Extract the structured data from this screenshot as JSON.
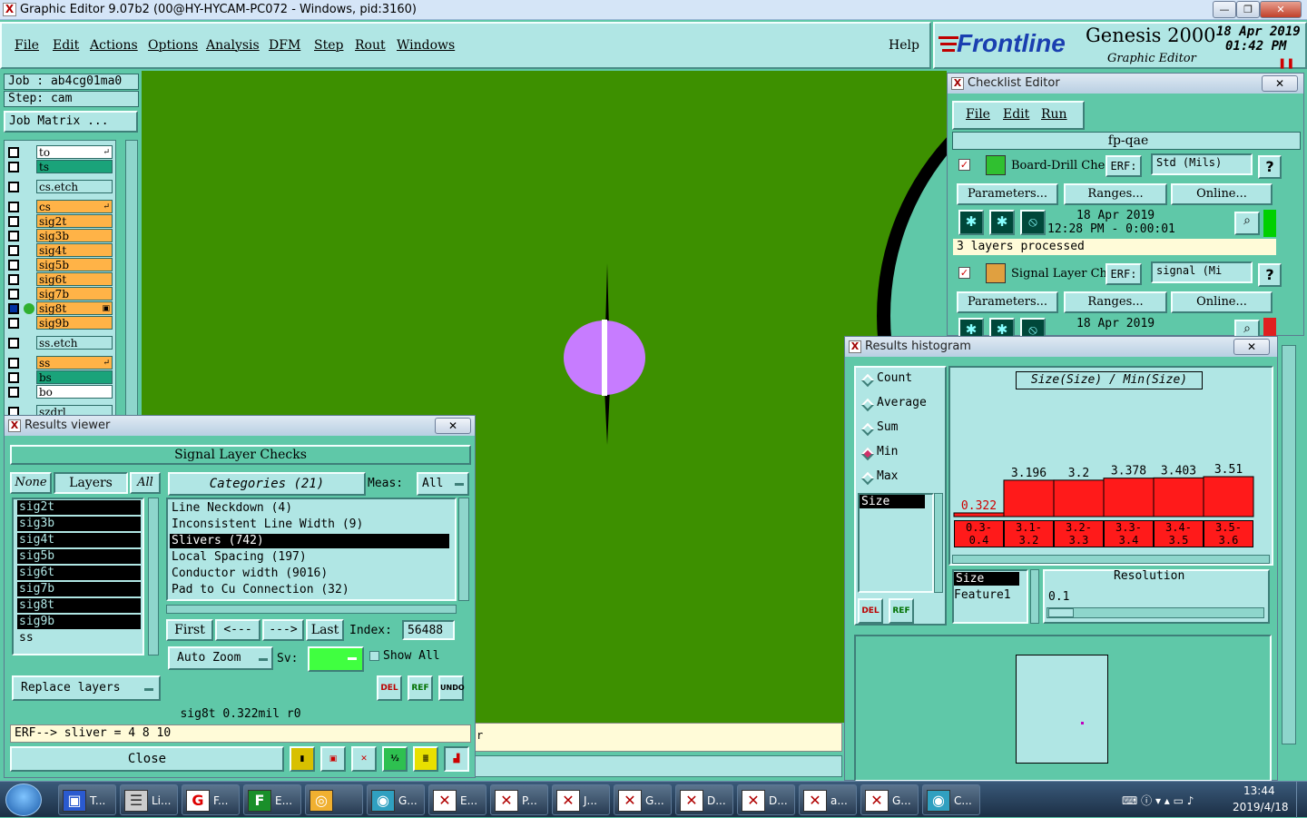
{
  "window": {
    "title": "Graphic Editor 9.07b2 (00@HY-HYCAM-PC072 - Windows, pid:3160)",
    "min": "—",
    "max": "❐",
    "close": "✕"
  },
  "menu": [
    "File",
    "Edit",
    "Actions",
    "Options",
    "Analysis",
    "DFM",
    "Step",
    "Rout",
    "Windows"
  ],
  "help": "Help",
  "brand": {
    "logo": "Frontline",
    "product": "Genesis 2000",
    "subtitle": "Graphic Editor",
    "date": "18 Apr 2019",
    "time": "01:42 PM",
    "accent": "#c00000"
  },
  "job": {
    "job_text": "Job : ab4cg01ma0",
    "step_text": "Step: cam",
    "matrix_button": "Job Matrix ..."
  },
  "layers": [
    {
      "name": "to",
      "color": "#ffffff",
      "mark": "↵"
    },
    {
      "name": "ts",
      "color": "#1aa37a",
      "mark": ""
    },
    {
      "name": "cs.etch",
      "color": "#b0e6e4",
      "mark": ""
    },
    {
      "name": "cs",
      "color": "#ffb347",
      "mark": "↵"
    },
    {
      "name": "sig2t",
      "color": "#ffb347",
      "mark": ""
    },
    {
      "name": "sig3b",
      "color": "#ffb347",
      "mark": ""
    },
    {
      "name": "sig4t",
      "color": "#ffb347",
      "mark": ""
    },
    {
      "name": "sig5b",
      "color": "#ffb347",
      "mark": ""
    },
    {
      "name": "sig6t",
      "color": "#ffb347",
      "mark": ""
    },
    {
      "name": "sig7b",
      "color": "#ffb347",
      "mark": ""
    },
    {
      "name": "sig8t",
      "color": "#ffb347",
      "mark": "▣"
    },
    {
      "name": "sig9b",
      "color": "#ffb347",
      "mark": ""
    },
    {
      "name": "ss.etch",
      "color": "#b0e6e4",
      "mark": ""
    },
    {
      "name": "ss",
      "color": "#ffb347",
      "mark": "↵"
    },
    {
      "name": "bs",
      "color": "#1aa37a",
      "mark": ""
    },
    {
      "name": "bo",
      "color": "#ffffff",
      "mark": ""
    },
    {
      "name": "szdrl",
      "color": "#b0e6e4",
      "mark": ""
    }
  ],
  "results_viewer": {
    "title": "Results viewer",
    "header": "Signal Layer Checks",
    "btn_none": "None",
    "btn_layers": "Layers",
    "btn_all": "All",
    "categories_btn": "Categories (21)",
    "meas_label": "Meas:",
    "meas_value": "All",
    "layer_list": [
      "sig2t",
      "sig3b",
      "sig4t",
      "sig5b",
      "sig6t",
      "sig7b",
      "sig8t",
      "sig9b",
      "ss"
    ],
    "category_list": [
      "Line Neckdown (4)",
      "Inconsistent Line Width (9)",
      "Slivers (742)",
      "Local Spacing (197)",
      "Conductor width (9016)",
      "Pad to Cu Connection (32)"
    ],
    "selected_category": "Slivers (742)",
    "nav_first": "First",
    "nav_prev": "<---",
    "nav_next": "--->",
    "nav_last": "Last",
    "index_label": "Index:",
    "index_value": "56488",
    "auto_zoom": "Auto Zoom",
    "sv_label": "Sv:",
    "show_all": "Show All",
    "del": "DEL",
    "ref": "REF",
    "undo": "UNDO",
    "replace_layers": "Replace layers",
    "status": "sig8t 0.322mil  r0",
    "erf": "ERF--> sliver = 4 8 10",
    "close": "Close"
  },
  "checklist": {
    "title": "Checklist Editor",
    "menu": [
      "File",
      "Edit",
      "Run"
    ],
    "name": "fp-qae",
    "checks": [
      {
        "name": "Board-Drill Che",
        "erf_label": "ERF:",
        "erf_value": "Std (Mils)",
        "help": "?",
        "params": "Parameters...",
        "ranges": "Ranges...",
        "online": "Online...",
        "date": "18 Apr 2019",
        "time": "12:28 PM - 0:00:01",
        "status": "3 layers processed",
        "status_color": "#00d000"
      },
      {
        "name": "Signal Layer Ch",
        "erf_label": "ERF:",
        "erf_value": "signal (Mi",
        "help": "?",
        "params": "Parameters...",
        "ranges": "Ranges...",
        "online": "Online...",
        "date": "18 Apr 2019",
        "time": "",
        "status": "",
        "status_color": "#e02020"
      }
    ]
  },
  "histogram": {
    "title": "Results histogram",
    "modes": [
      "Count",
      "Average",
      "Sum",
      "Min",
      "Max"
    ],
    "selected_mode": "Min",
    "list_item": "Size",
    "chart_title": "Size(Size) / Min(Size)",
    "bins": [
      {
        "range_top": "0.3-",
        "range_bot": "0.4",
        "value": "0.322",
        "v": 0.322
      },
      {
        "range_top": "3.1-",
        "range_bot": "3.2",
        "value": "3.196",
        "v": 3.196
      },
      {
        "range_top": "3.2-",
        "range_bot": "3.3",
        "value": "3.2",
        "v": 3.2
      },
      {
        "range_top": "3.3-",
        "range_bot": "3.4",
        "value": "3.378",
        "v": 3.378
      },
      {
        "range_top": "3.4-",
        "range_bot": "3.5",
        "value": "3.403",
        "v": 3.403
      },
      {
        "range_top": "3.5-",
        "range_bot": "3.6",
        "value": "3.51",
        "v": 3.51
      }
    ],
    "bar_color": "#ff1a1a",
    "attr_list": [
      "Size",
      "Feature1"
    ],
    "resolution_label": "Resolution",
    "resolution_value": "0.1",
    "del": "DEL",
    "ref": "REF"
  },
  "status_bar_fragment": "r",
  "taskbar": {
    "items": [
      {
        "label": "T...",
        "icon": "disk-icon"
      },
      {
        "label": "Li...",
        "icon": "stack-icon"
      },
      {
        "label": "F...",
        "icon": "g-icon"
      },
      {
        "label": "E...",
        "icon": "f-icon"
      },
      {
        "label": "",
        "icon": "shell-icon"
      },
      {
        "label": "G...",
        "icon": "eye-icon"
      },
      {
        "label": "E...",
        "icon": "x-icon"
      },
      {
        "label": "P...",
        "icon": "x-icon"
      },
      {
        "label": "J...",
        "icon": "x-icon"
      },
      {
        "label": "G...",
        "icon": "x-icon"
      },
      {
        "label": "D...",
        "icon": "x-icon"
      },
      {
        "label": "D...",
        "icon": "x-icon"
      },
      {
        "label": "a...",
        "icon": "x-icon"
      },
      {
        "label": "G...",
        "icon": "x-icon"
      },
      {
        "label": "C...",
        "icon": "eye-icon"
      }
    ],
    "clock_time": "13:44",
    "clock_date": "2019/4/18"
  }
}
